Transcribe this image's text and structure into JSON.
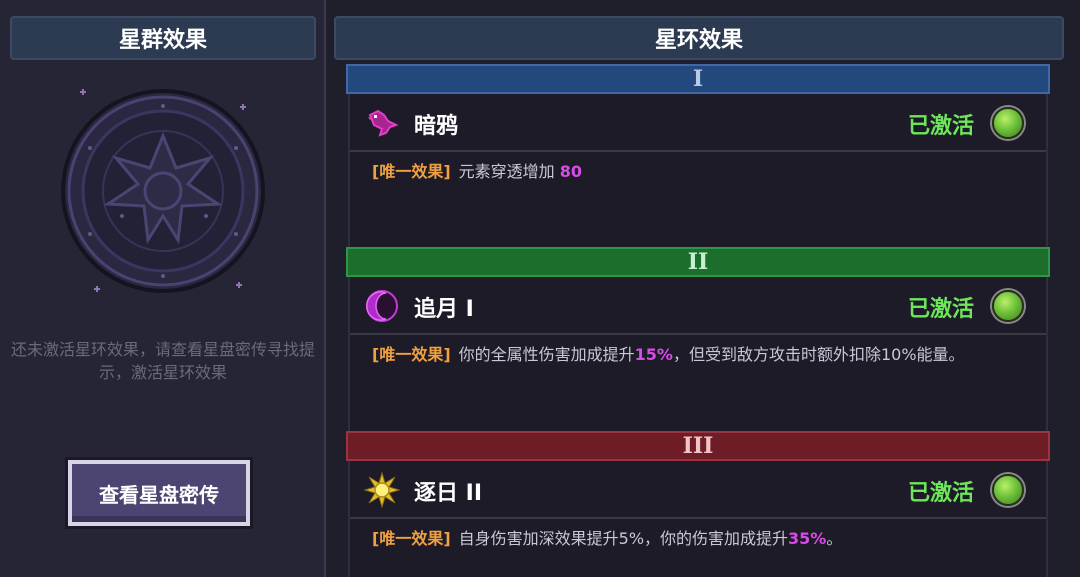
{
  "left": {
    "title": "星群效果",
    "hint": "还未激活星环效果，请查看星盘密传寻找提示，激活星环效果",
    "button_label": "查看星盘密传"
  },
  "right": {
    "title": "星环效果",
    "tiers": [
      {
        "numeral": "I",
        "color": "#23487e",
        "effect": {
          "icon": "crow-icon",
          "name": "暗鸦",
          "status": "已激活",
          "tag": "[唯一效果]",
          "desc_a": "元素穿透增加",
          "value_1": "80",
          "desc_b": "",
          "value_2": "",
          "desc_c": ""
        }
      },
      {
        "numeral": "II",
        "color": "#1c6e2d",
        "effect": {
          "icon": "crescent-moon-icon",
          "name": "追月 I",
          "status": "已激活",
          "tag": "[唯一效果]",
          "desc_a": "你的全属性伤害加成提升",
          "value_1": "15%",
          "desc_b": "，但受到敌方攻击时额外扣除10%能量。",
          "value_2": "",
          "desc_c": ""
        }
      },
      {
        "numeral": "III",
        "color": "#6e1c25",
        "effect": {
          "icon": "sun-icon",
          "name": "逐日 II",
          "status": "已激活",
          "tag": "[唯一效果]",
          "desc_a": "自身伤害加深效果提升5%，你的伤害加成提升",
          "value_1": "35%",
          "desc_b": "。",
          "value_2": "",
          "desc_c": ""
        }
      }
    ]
  },
  "colors": {
    "status_active": "#6ee65a",
    "effect_tag": "#f0a040",
    "value_highlight": "#d94be8"
  }
}
